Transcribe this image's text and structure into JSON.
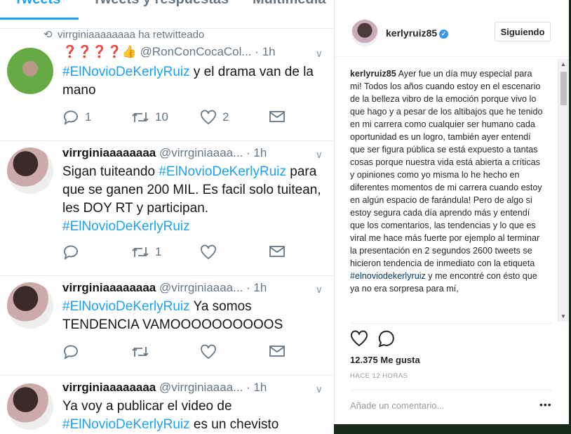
{
  "twitter": {
    "tabs": [
      "Tweets",
      "Tweets y respuestas",
      "Multimedia"
    ],
    "retweet_note": "virrginiaaaaaaaa ha retwitteado",
    "tweets": [
      {
        "name": "👍",
        "name_prefix": "❓❓❓❓",
        "handle": "@RonConCocaCol...",
        "time": "· 1h",
        "text_parts": [
          "#ElNovioDeKerlyRuiz",
          " y el drama van de la mano"
        ],
        "replies": "1",
        "retweets": "10",
        "likes": "2"
      },
      {
        "name": "virrginiaaaaaaaa",
        "handle": "@virrginiaaaa...",
        "time": "· 1h",
        "text_a": "Sigan tuiteando ",
        "hashtag_a": "#ElNovioDeKerlyRuiz",
        "text_b": " para que se ganen 200 MIL. Es facil solo tuitean, les DOY RT y participan. ",
        "hashtag_b": "#ElNovioDeKerlyRuiz",
        "replies": "",
        "retweets": "1",
        "likes": ""
      },
      {
        "name": "virrginiaaaaaaaa",
        "handle": "@virrginiaaaa...",
        "time": "· 1h",
        "hashtag_a": "#ElNovioDeKerlyRuiz",
        "text_b": " Ya somos TENDENCIA VAMOOOOOOOOOOS"
      },
      {
        "name": "virrginiaaaaaaaa",
        "handle": "@virrginiaaaa...",
        "time": "· 1h",
        "text_a": "Ya voy a publicar el video de ",
        "hashtag_a": "#ElNovioDeKerlyRuiz",
        "text_b": " es un chevisto"
      }
    ]
  },
  "instagram": {
    "username": "kerlyruiz85",
    "follow_label": "Siguiendo",
    "caption_user": "kerlyruiz85",
    "caption_text": " Ayer fue un día muy especial para mi! Todos los años cuando estoy en el escenario de la belleza vibro de la emoción porque vivo lo que hago y a pesar de los altibajos que he tenido en mi carrera como cualquier ser humano cada oportunidad es un logro, también ayer entendí que ser figura pública se está expuesto a tantas cosas porque nuestra vida está abierta a críticas y opiniones como yo misma lo he hecho en diferentes momentos de mi carrera cuando estoy en algún espacio de farándula! Pero de algo si estoy segura cada día aprendo más y entendí que los comentarios, las tendencias y lo que es viral me hace más fuerte por ejemplo al terminar la presentación en 2 segundos 2600 tweets se hicieron tendencia de inmediato con la etiqueta ",
    "caption_hashtag": "#elnoviodekerlyruiz",
    "caption_tail": " y me encontré con ésto que ya no era sorpresa para mí,",
    "likes": "12.375 Me gusta",
    "time": "HACE 12 HORAS",
    "comment_placeholder": "Añade un comentario...",
    "more": "•••",
    "accent": "#3897f0"
  }
}
